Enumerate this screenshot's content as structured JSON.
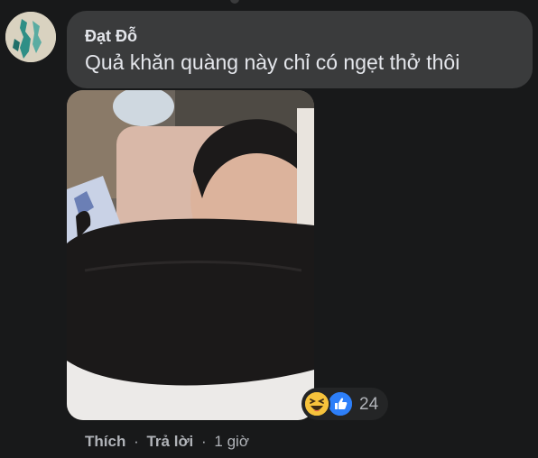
{
  "comment": {
    "author": "Đạt Đỗ",
    "text": "Quả khăn quàng này chỉ có ngẹt thở thôi",
    "attachment": "photo",
    "avatar_icon": "user-avatar"
  },
  "reactions": {
    "icons": [
      "haha-emoji-icon",
      "like-icon"
    ],
    "count": "24"
  },
  "actions": {
    "like_label": "Thích",
    "reply_label": "Trả lời",
    "separator": "·",
    "time": "1 giờ"
  },
  "colors": {
    "background": "#18191a",
    "bubble": "#3a3b3c",
    "text": "#e4e6eb",
    "secondary_text": "#b0b3b8",
    "like_blue": "#2d7ff9",
    "haha_yellow": "#f7c33c"
  }
}
